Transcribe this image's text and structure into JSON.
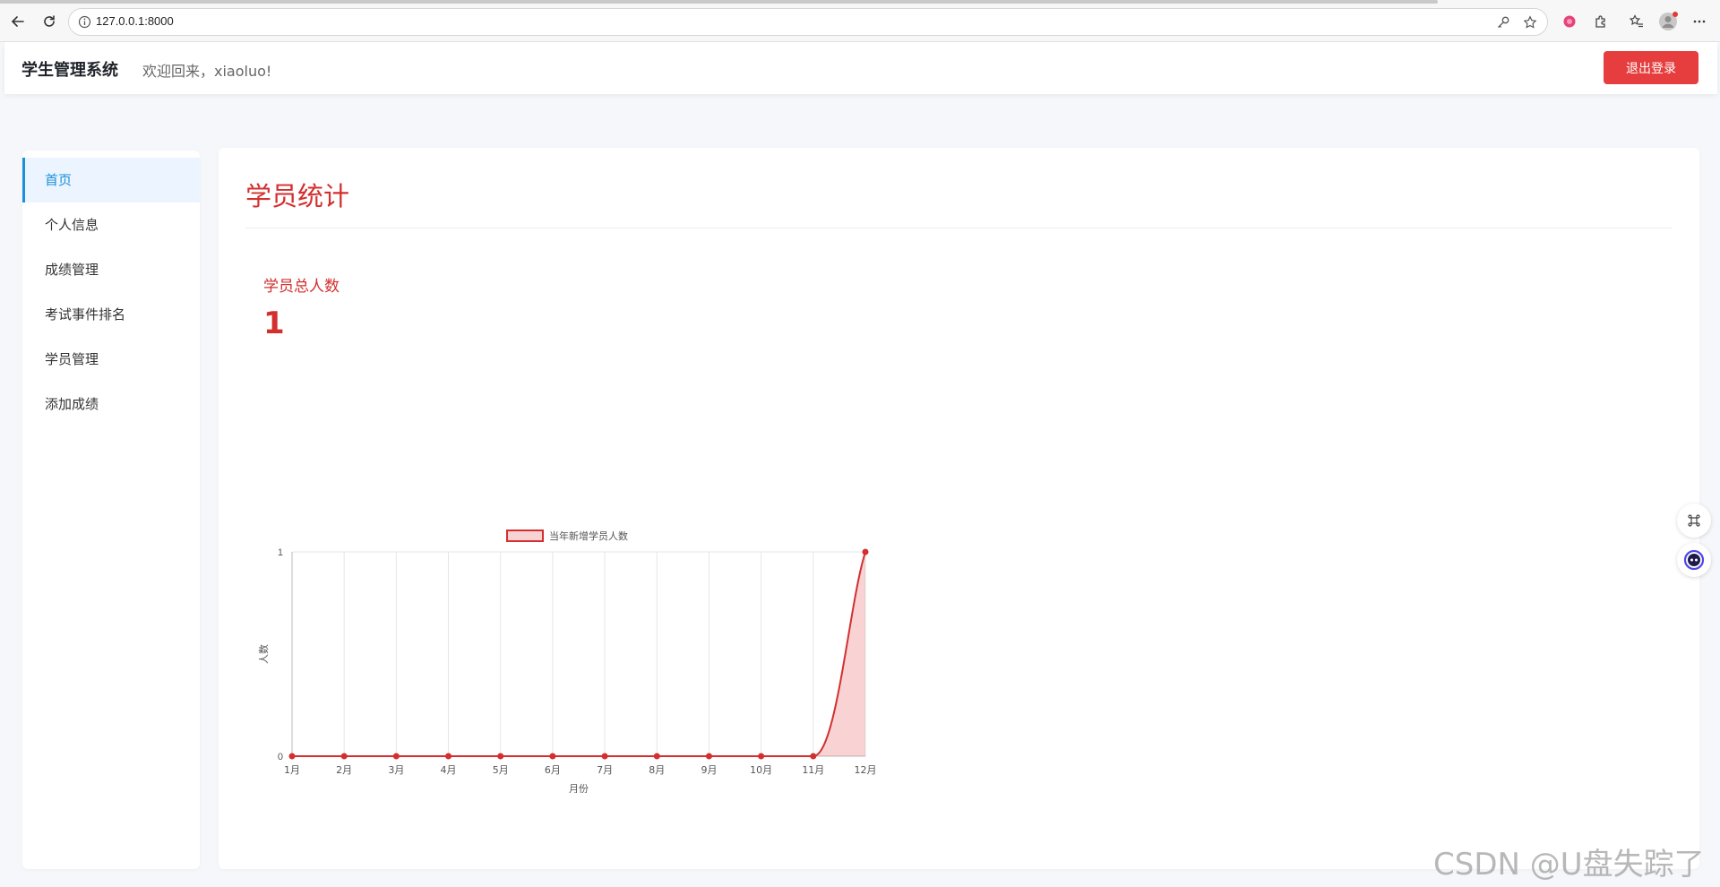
{
  "browser": {
    "url": "127.0.0.1:8000"
  },
  "header": {
    "title": "学生管理系统",
    "welcome": "欢迎回来，xiaoluo!",
    "logout_label": "退出登录"
  },
  "sidebar": {
    "items": [
      {
        "label": "首页",
        "active": true
      },
      {
        "label": "个人信息",
        "active": false
      },
      {
        "label": "成绩管理",
        "active": false
      },
      {
        "label": "考试事件排名",
        "active": false
      },
      {
        "label": "学员管理",
        "active": false
      },
      {
        "label": "添加成绩",
        "active": false
      }
    ]
  },
  "main": {
    "title": "学员统计",
    "stat_label": "学员总人数",
    "stat_value": "1"
  },
  "colors": {
    "accent": "#d32f2f",
    "active_menu": "#1a8fdb",
    "logout": "#e63e3e"
  },
  "chart_data": {
    "type": "line",
    "legend": [
      "当年新增学员人数"
    ],
    "legend_position": "top",
    "categories": [
      "1月",
      "2月",
      "3月",
      "4月",
      "5月",
      "6月",
      "7月",
      "8月",
      "9月",
      "10月",
      "11月",
      "12月"
    ],
    "series": [
      {
        "name": "当年新增学员人数",
        "values": [
          0,
          0,
          0,
          0,
          0,
          0,
          0,
          0,
          0,
          0,
          0,
          1
        ],
        "fill": true
      }
    ],
    "xlabel": "月份",
    "ylabel": "人数",
    "ylim": [
      0,
      1
    ],
    "yticks": [
      "0",
      "1"
    ],
    "grid": true
  },
  "watermark": "CSDN @U盘失踪了"
}
